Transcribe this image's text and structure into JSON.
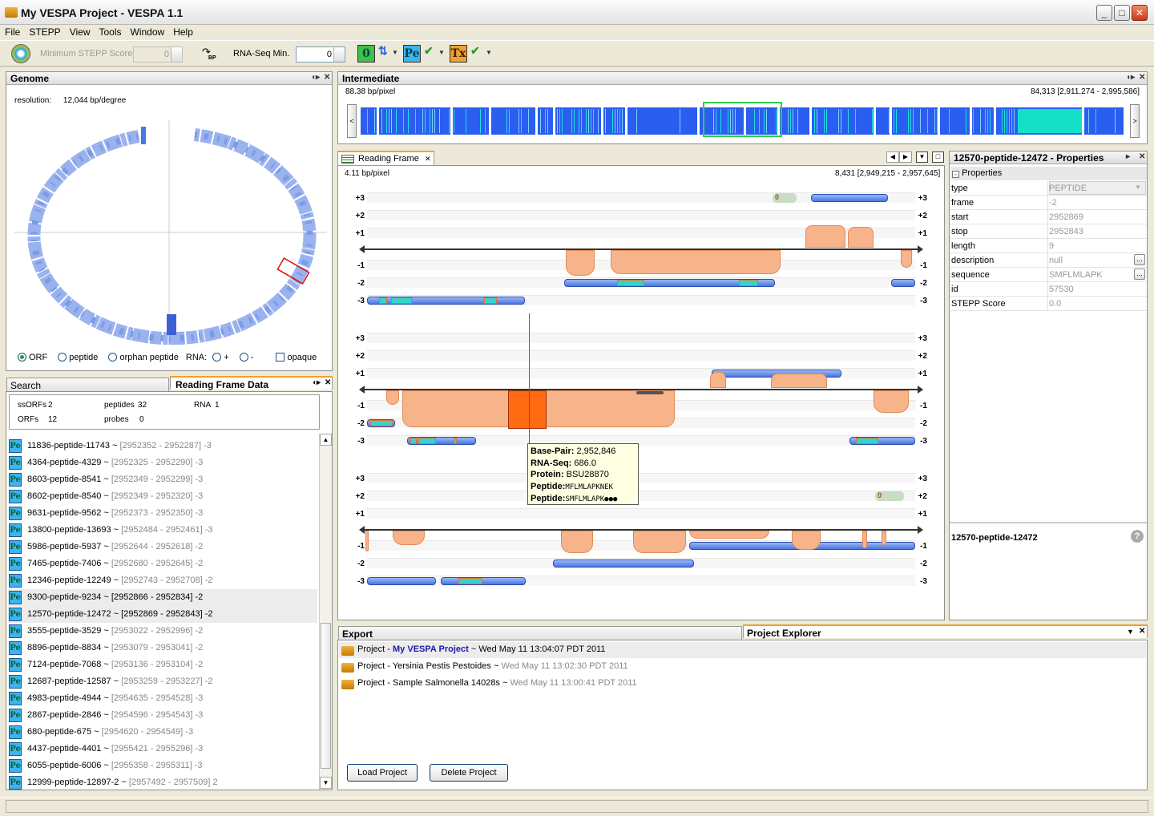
{
  "window": {
    "title": "My VESPA Project - VESPA 1.1"
  },
  "menu": [
    "File",
    "STEPP",
    "View",
    "Tools",
    "Window",
    "Help"
  ],
  "toolbar": {
    "min_stepp_label": "Minimum STEPP Score",
    "min_stepp_value": "0",
    "bp_label": "BP",
    "rnaseq_label": "RNA-Seq Min.",
    "rnaseq_value": "0",
    "icons": [
      {
        "name": "orf-filter-icon",
        "text": "0"
      },
      {
        "name": "peptide-filter-icon",
        "text": "Pe"
      },
      {
        "name": "transcript-filter-icon",
        "text": "Tx"
      }
    ]
  },
  "genome": {
    "title": "Genome",
    "resolution_label": "resolution:",
    "resolution_value": "12,044",
    "resolution_unit": "bp/degree",
    "options": [
      "ORF",
      "peptide",
      "orphan peptide"
    ],
    "rna_label": "RNA:",
    "rna_plus": "+",
    "rna_minus": "-",
    "opaque_label": "opaque"
  },
  "intermediate": {
    "title": "Intermediate",
    "scale": "88.38 bp/pixel",
    "range": "84,313 [2,911,274 - 2,995,586]",
    "left_arrow": "<",
    "right_arrow": ">"
  },
  "reading_frame": {
    "tab_label": "Reading Frame",
    "scale": "4.11 bp/pixel",
    "range": "8,431 [2,949,215 - 2,957,645]",
    "frame_labels": [
      "+3",
      "+2",
      "+1",
      "-1",
      "-2",
      "-3"
    ],
    "tooltip": {
      "basepair_label": "Base-Pair:",
      "basepair_value": "2,952,846",
      "rnaseq_label": "RNA-Seq:",
      "rnaseq_value": "686.0",
      "protein_label": "Protein:",
      "protein_value": "BSU28870",
      "peptide1_label": "Peptide:",
      "peptide1_value": "MFLMLAPKNEK",
      "peptide2_label": "Peptide:",
      "peptide2_value": "SMFLMLAPK●●●"
    },
    "badge_zero": "0"
  },
  "properties": {
    "title": "12570-peptide-12472 - Properties",
    "section": "Properties",
    "rows": [
      {
        "key": "type",
        "value": "PEPTIDE"
      },
      {
        "key": "frame",
        "value": "-2"
      },
      {
        "key": "start",
        "value": "2952869"
      },
      {
        "key": "stop",
        "value": "2952843"
      },
      {
        "key": "length",
        "value": "9"
      },
      {
        "key": "description",
        "value": "null"
      },
      {
        "key": "sequence",
        "value": "SMFLMLAPK"
      },
      {
        "key": "id",
        "value": "57530"
      },
      {
        "key": "STEPP Score",
        "value": "0.0"
      }
    ],
    "footer_name": "12570-peptide-12472",
    "dots": "..."
  },
  "left_tabs": {
    "search": "Search",
    "rfdata": "Reading Frame Data"
  },
  "rfdata": {
    "ssorfs_label": "ssORFs",
    "ssorfs": "2",
    "orfs_label": "ORFs",
    "orfs": "12",
    "peptides_label": "peptides",
    "peptides": "32",
    "probes_label": "probes",
    "probes": "0",
    "rna_label": "RNA",
    "rna": "1"
  },
  "peptide_list": [
    {
      "name": "11836-peptide-11743",
      "range": "[2952352 - 2952287]",
      "frame": "-3"
    },
    {
      "name": "4364-peptide-4329",
      "range": "[2952325 - 2952290]",
      "frame": "-3"
    },
    {
      "name": "8603-peptide-8541",
      "range": "[2952349 - 2952299]",
      "frame": "-3"
    },
    {
      "name": "8602-peptide-8540",
      "range": "[2952349 - 2952320]",
      "frame": "-3"
    },
    {
      "name": "9631-peptide-9562",
      "range": "[2952373 - 2952350]",
      "frame": "-3"
    },
    {
      "name": "13800-peptide-13693",
      "range": "[2952484 - 2952461]",
      "frame": "-3"
    },
    {
      "name": "5986-peptide-5937",
      "range": "[2952644 - 2952618]",
      "frame": "-2"
    },
    {
      "name": "7465-peptide-7406",
      "range": "[2952680 - 2952645]",
      "frame": "-2"
    },
    {
      "name": "12346-peptide-12249",
      "range": "[2952743 - 2952708]",
      "frame": "-2"
    },
    {
      "name": "9300-peptide-9234",
      "range": "[2952866 - 2952834]",
      "frame": "-2"
    },
    {
      "name": "12570-peptide-12472",
      "range": "[2952869 - 2952843]",
      "frame": "-2"
    },
    {
      "name": "3555-peptide-3529",
      "range": "[2953022 - 2952996]",
      "frame": "-2"
    },
    {
      "name": "8896-peptide-8834",
      "range": "[2953079 - 2953041]",
      "frame": "-2"
    },
    {
      "name": "7124-peptide-7068",
      "range": "[2953136 - 2953104]",
      "frame": "-2"
    },
    {
      "name": "12687-peptide-12587",
      "range": "[2953259 - 2953227]",
      "frame": "-2"
    },
    {
      "name": "4983-peptide-4944",
      "range": "[2954635 - 2954528]",
      "frame": "-3"
    },
    {
      "name": "2867-peptide-2846",
      "range": "[2954596 - 2954543]",
      "frame": "-3"
    },
    {
      "name": "680-peptide-675",
      "range": "[2954620 - 2954549]",
      "frame": "-3"
    },
    {
      "name": "4437-peptide-4401",
      "range": "[2955421 - 2955296]",
      "frame": "-3"
    },
    {
      "name": "6055-peptide-6006",
      "range": "[2955358 - 2955311]",
      "frame": "-3"
    },
    {
      "name": "12999-peptide-12897-2",
      "range": "[2957492 - 2957509]",
      "frame": "2"
    }
  ],
  "bottom_tabs": {
    "export": "Export",
    "explorer": "Project Explorer"
  },
  "projects": [
    {
      "prefix": "Project - ",
      "name": "My VESPA Project",
      "sep": " ~ ",
      "date": "Wed May 11 13:04:07 PDT 2011"
    },
    {
      "prefix": "Project - ",
      "name": "Yersinia Pestis Pestoides",
      "sep": " ~ ",
      "date": "Wed May 11 13:02:30 PDT 2011"
    },
    {
      "prefix": "Project - ",
      "name": "Sample Salmonella 14028s",
      "sep": " ~ ",
      "date": "Wed May 11 13:00:41 PDT 2011"
    }
  ],
  "buttons": {
    "load": "Load Project",
    "delete": "Delete Project"
  },
  "colors": {
    "accent": "#f0a030",
    "gene": "#4a76e0",
    "rnaseq": "#f7b48a",
    "peptide": "#37d3c9"
  }
}
